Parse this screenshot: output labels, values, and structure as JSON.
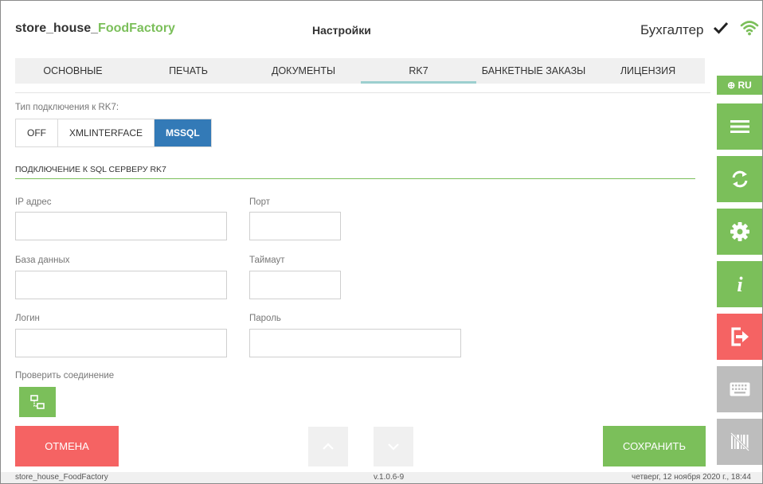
{
  "header": {
    "brand_prefix": "store_house_",
    "brand_accent": "FoodFactory",
    "page_title": "Настройки",
    "user": "Бухгалтер"
  },
  "tabs": [
    {
      "label": "ОСНОВНЫЕ",
      "active": false
    },
    {
      "label": "ПЕЧАТЬ",
      "active": false
    },
    {
      "label": "ДОКУМЕНТЫ",
      "active": false
    },
    {
      "label": "RK7",
      "active": true
    },
    {
      "label": "БАНКЕТНЫЕ ЗАКАЗЫ",
      "active": false
    },
    {
      "label": "ЛИЦЕНЗИЯ",
      "active": false
    }
  ],
  "sidebar": {
    "lang": "⊕ RU",
    "buttons": [
      {
        "icon": "menu-icon",
        "color": "#7bbf5a"
      },
      {
        "icon": "sync-icon",
        "color": "#7bbf5a"
      },
      {
        "icon": "gear-icon",
        "color": "#7bbf5a"
      },
      {
        "icon": "info-icon",
        "color": "#7bbf5a"
      },
      {
        "icon": "logout-icon",
        "color": "#f56363"
      },
      {
        "icon": "keyboard-icon",
        "color": "#bdbdbd"
      },
      {
        "icon": "barcode-icon",
        "color": "#bdbdbd"
      }
    ]
  },
  "connection": {
    "label": "Тип подключения к RK7:",
    "options": [
      {
        "label": "OFF",
        "active": false
      },
      {
        "label": "XMLINTERFACE",
        "active": false
      },
      {
        "label": "MSSQL",
        "active": true
      }
    ]
  },
  "sql": {
    "section_title": "ПОДКЛЮЧЕНИЕ К SQL СЕРВЕРУ RK7",
    "fields": {
      "ip": {
        "label": "IP адрес",
        "value": ""
      },
      "port": {
        "label": "Порт",
        "value": ""
      },
      "database": {
        "label": "База данных",
        "value": ""
      },
      "timeout": {
        "label": "Таймаут",
        "value": ""
      },
      "login": {
        "label": "Логин",
        "value": ""
      },
      "password": {
        "label": "Пароль",
        "value": ""
      }
    },
    "check_label": "Проверить соединение"
  },
  "actions": {
    "cancel": "ОТМЕНА",
    "save": "СОХРАНИТЬ"
  },
  "footer": {
    "app": "store_house_FoodFactory",
    "version": "v.1.0.6-9",
    "datetime": "четверг, 12 ноября 2020 г., 18:44"
  },
  "colors": {
    "accent_green": "#7bbf5a",
    "danger_red": "#f56363",
    "active_blue": "#337ab7",
    "disabled_gray": "#bdbdbd"
  }
}
